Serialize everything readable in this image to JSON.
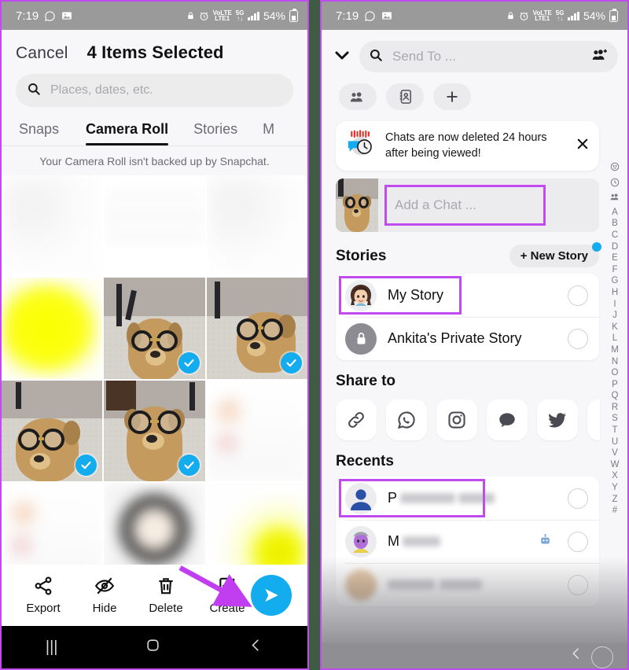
{
  "status_bar": {
    "time": "7:19",
    "battery_percent": "54%",
    "network_label": "VoLTE",
    "network_gen": "5G",
    "icons": [
      "whatsapp-icon",
      "gallery-icon",
      "lock-icon",
      "alarm-icon",
      "volte-icon",
      "5g-icon",
      "signal-bars-icon",
      "battery-icon"
    ]
  },
  "left_panel": {
    "cancel_label": "Cancel",
    "title": "4 Items Selected",
    "search_placeholder": "Places, dates, etc.",
    "tabs": [
      {
        "label": "Snaps",
        "active": false
      },
      {
        "label": "Camera Roll",
        "active": true
      },
      {
        "label": "Stories",
        "active": false
      },
      {
        "label": "M",
        "active": false
      }
    ],
    "notice": "Your Camera Roll isn't backed up by Snapchat.",
    "grid": {
      "selected_count": 4,
      "cells": [
        {
          "kind": "blurred-white",
          "selected": false
        },
        {
          "kind": "blurred-document",
          "selected": false
        },
        {
          "kind": "blurred-white",
          "selected": false
        },
        {
          "kind": "blurred-yellow",
          "selected": false
        },
        {
          "kind": "dog-photo",
          "selected": true
        },
        {
          "kind": "dog-photo",
          "selected": true
        },
        {
          "kind": "dog-photo",
          "selected": true
        },
        {
          "kind": "dog-photo",
          "selected": true
        },
        {
          "kind": "blurred-pink-document",
          "selected": false
        },
        {
          "kind": "blurred-white",
          "selected": false
        },
        {
          "kind": "blurred-framed",
          "selected": false
        },
        {
          "kind": "blurred-yellow-flower",
          "selected": false
        }
      ]
    },
    "toolbar": [
      {
        "label": "Export",
        "icon": "share-icon"
      },
      {
        "label": "Hide",
        "icon": "eye-slash-icon"
      },
      {
        "label": "Delete",
        "icon": "trash-icon"
      },
      {
        "label": "Create",
        "icon": "create-icon"
      }
    ],
    "send_button_icon": "send-arrow-icon",
    "send_button_color": "#12acef",
    "annotation_arrow_color": "#c04cf0"
  },
  "right_panel": {
    "collapse_icon": "chevron-down-icon",
    "search_placeholder": "Send To ...",
    "add_friends_icon": "add-group-icon",
    "chips": [
      {
        "icon": "group-icon"
      },
      {
        "icon": "contact-book-icon"
      },
      {
        "icon": "plus-icon"
      }
    ],
    "banner": {
      "text": "Chats are now deleted 24 hours after being viewed!",
      "icon": "chat-clock-icon",
      "close_icon": "close-icon"
    },
    "chat_row": {
      "thumbnail": "dog-photo-thumbnail",
      "placeholder": "Add a Chat ...",
      "highlighted": true
    },
    "stories": {
      "title": "Stories",
      "new_story_label": "+ New Story",
      "new_story_badge": true,
      "items": [
        {
          "label": "My Story",
          "avatar": "bitmoji-avatar",
          "highlighted": true,
          "selected": false
        },
        {
          "label": "Ankita's Private Story",
          "avatar": "lock-icon",
          "highlighted": false,
          "selected": false
        }
      ]
    },
    "share_to": {
      "title": "Share to",
      "items": [
        {
          "icon": "link-icon"
        },
        {
          "icon": "whatsapp-icon"
        },
        {
          "icon": "instagram-icon"
        },
        {
          "icon": "message-bubble-icon"
        },
        {
          "icon": "twitter-icon"
        },
        {
          "icon": "more-icon"
        }
      ]
    },
    "recents": {
      "title": "Recents",
      "items": [
        {
          "label": "P",
          "avatar": "person-icon",
          "highlighted": true,
          "badge": "",
          "selected": false
        },
        {
          "label": "M",
          "avatar": "bitmoji-avatar",
          "highlighted": false,
          "badge": "robot-icon",
          "selected": false
        },
        {
          "label": "",
          "avatar": "blurred-avatar",
          "highlighted": false,
          "badge": "",
          "selected": false
        }
      ]
    },
    "index_strip": [
      "smiley-icon",
      "clock-icon",
      "group-icon",
      "A",
      "B",
      "C",
      "D",
      "E",
      "F",
      "G",
      "H",
      "I",
      "J",
      "K",
      "L",
      "M",
      "N",
      "O",
      "P",
      "Q",
      "R",
      "S",
      "T",
      "U",
      "V",
      "W",
      "X",
      "Y",
      "Z",
      "#"
    ],
    "back_icon": "back-chevron-icon"
  },
  "android_nav": {
    "recents_icon": "recents-icon",
    "home_icon": "home-icon",
    "back_icon": "back-icon"
  },
  "colors": {
    "accent_blue": "#12acef",
    "highlight_purple": "#c04cf0",
    "background_green": "#3f5b43"
  }
}
